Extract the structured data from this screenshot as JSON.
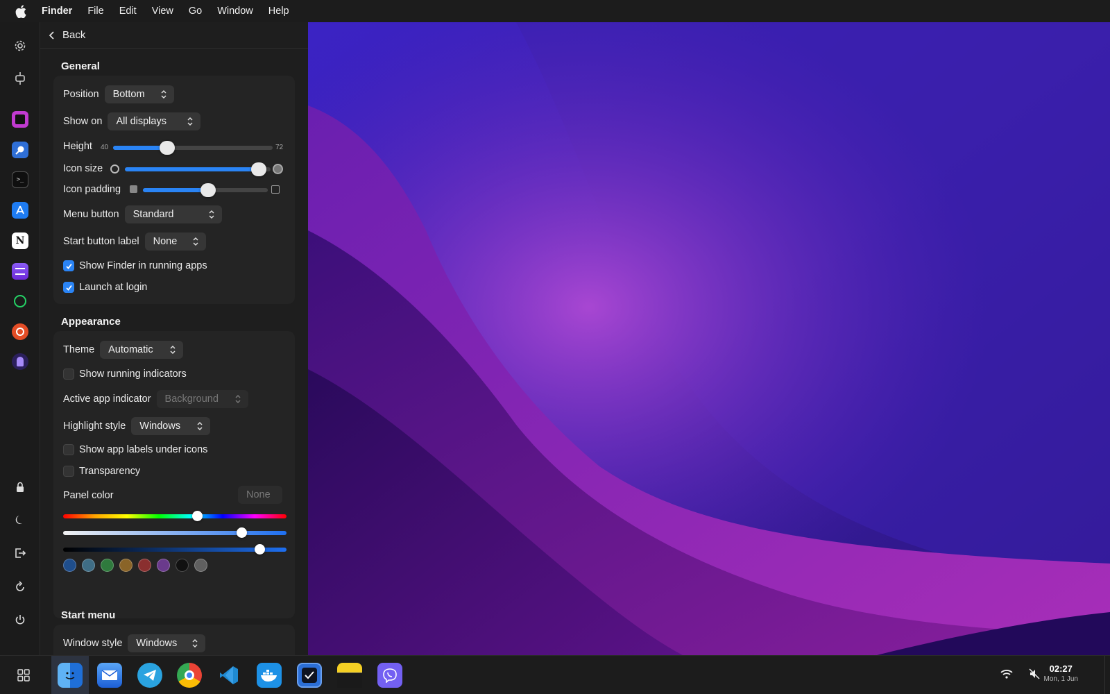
{
  "menubar": {
    "app_name": "Finder",
    "items": [
      "File",
      "Edit",
      "View",
      "Go",
      "Window",
      "Help"
    ]
  },
  "panel": {
    "back_label": "Back",
    "general": {
      "title": "General",
      "position_label": "Position",
      "position_value": "Bottom",
      "show_on_label": "Show on",
      "show_on_value": "All displays",
      "height_label": "Height",
      "height_min": "40",
      "height_max": "72",
      "height_level": 0.34,
      "icon_size_label": "Icon size",
      "icon_size_level": 0.92,
      "icon_padding_label": "Icon padding",
      "icon_padding_level": 0.52,
      "menu_button_label": "Menu button",
      "menu_button_value": "Standard",
      "start_button_label_label": "Start button label",
      "start_button_label_value": "None",
      "show_finder_label": "Show Finder in running apps",
      "show_finder_checked": true,
      "launch_login_label": "Launch at login",
      "launch_login_checked": true
    },
    "appearance": {
      "title": "Appearance",
      "theme_label": "Theme",
      "theme_value": "Automatic",
      "running_indicators_label": "Show running indicators",
      "active_indicator_label": "Active app indicator",
      "active_indicator_value": "Background",
      "highlight_label": "Highlight style",
      "highlight_value": "Windows",
      "app_labels_label": "Show app labels under icons",
      "transparency_label": "Transparency",
      "panel_color_label": "Panel color",
      "panel_color_value": "None",
      "hue_level": 0.6,
      "saturation_level": 0.8,
      "brightness_level": 0.88,
      "swatches": [
        "#1f4e8c",
        "#3f6d85",
        "#2f7a3d",
        "#8a6428",
        "#8a2f2f",
        "#6a3a8c",
        "#111111",
        "#606060"
      ]
    },
    "start_menu": {
      "title": "Start menu",
      "window_style_label": "Window style",
      "window_style_value": "Windows"
    }
  },
  "rail": {
    "top_icons": [
      "settings-icon",
      "dock-icon"
    ],
    "apps": [
      "phpstorm-app",
      "proxyman-app",
      "terminal-app",
      "app-store-app",
      "notion-app",
      "tasks-app",
      "whatsapp-app",
      "network-app",
      "pinwheel-app"
    ],
    "bottom_icons": [
      "lock-icon",
      "moon-icon",
      "logout-icon",
      "restart-icon",
      "power-icon"
    ]
  },
  "taskbar": {
    "apps": [
      "finder",
      "mail",
      "telegram",
      "chrome",
      "vscode",
      "docker",
      "things",
      "notes",
      "viber"
    ],
    "time": "02:27",
    "date": "Mon, 1 Jun"
  },
  "colors": {
    "accent": "#2a84f5"
  }
}
